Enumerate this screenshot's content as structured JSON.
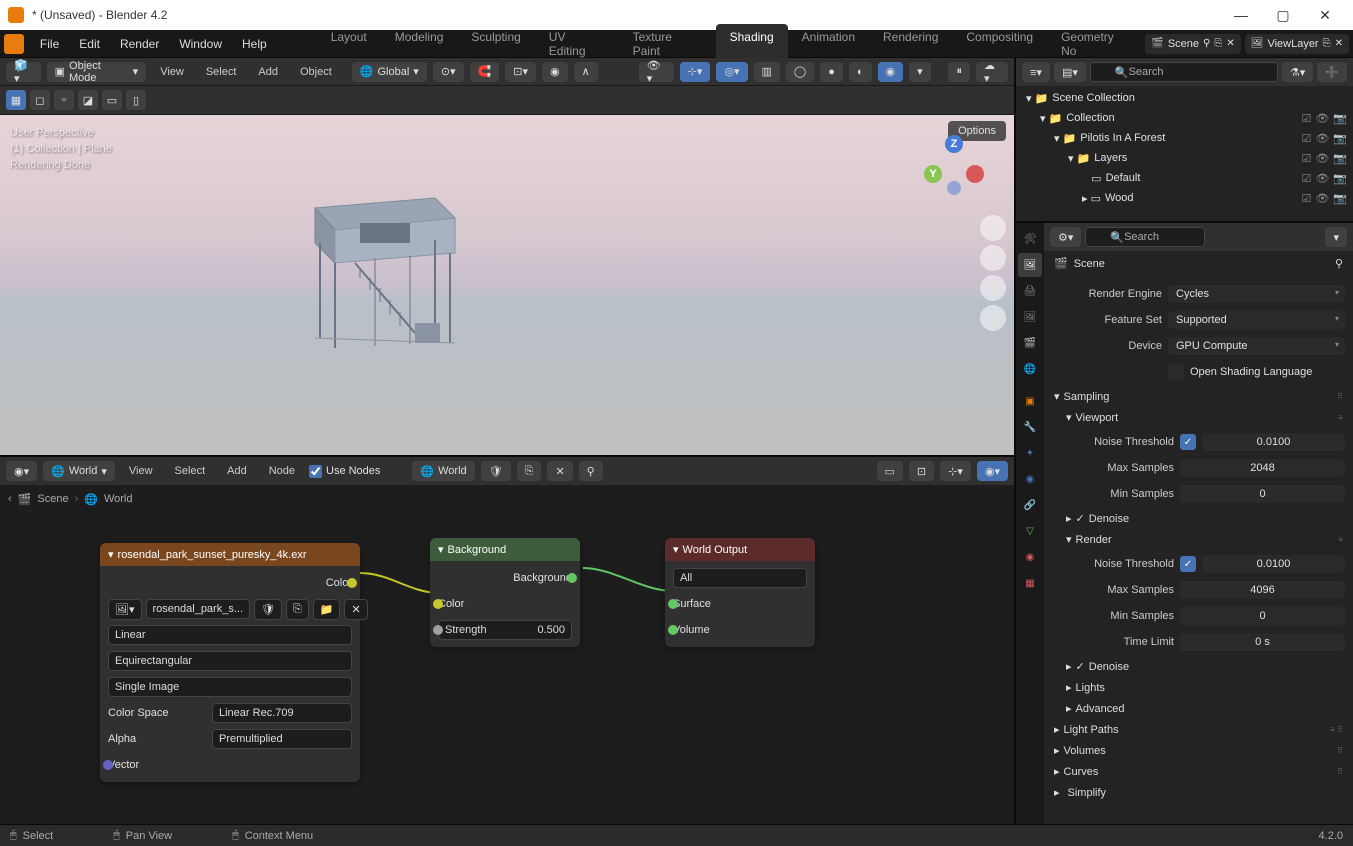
{
  "title": "* (Unsaved) - Blender 4.2",
  "menu": {
    "file": "File",
    "edit": "Edit",
    "render": "Render",
    "window": "Window",
    "help": "Help"
  },
  "tabs": [
    "Layout",
    "Modeling",
    "Sculpting",
    "UV Editing",
    "Texture Paint",
    "Shading",
    "Animation",
    "Rendering",
    "Compositing",
    "Geometry No"
  ],
  "active_tab": "Shading",
  "scene_name": "Scene",
  "layer_name": "ViewLayer",
  "vp_header": {
    "mode": "Object Mode",
    "view": "View",
    "select": "Select",
    "add": "Add",
    "object": "Object",
    "orient": "Global",
    "options": "Options"
  },
  "vp_overlay": {
    "l1": "User Perspective",
    "l2": "(1) Collection | Plane",
    "l3": "Rendering Done"
  },
  "ne_header": {
    "world": "World",
    "view": "View",
    "select": "Select",
    "add": "Add",
    "node": "Node",
    "use_nodes": "Use Nodes"
  },
  "breadcrumb": {
    "scene": "Scene",
    "world": "World"
  },
  "nodes": {
    "env": {
      "title": "rosendal_park_sunset_puresky_4k.exr",
      "color_out": "Color",
      "img": "rosendal_park_s...",
      "interp": "Linear",
      "proj": "Equirectangular",
      "single": "Single Image",
      "cs_label": "Color Space",
      "cs_val": "Linear Rec.709",
      "alpha_label": "Alpha",
      "alpha_val": "Premultiplied",
      "vector": "Vector"
    },
    "bg": {
      "title": "Background",
      "out": "Background",
      "color": "Color",
      "strength": "Strength",
      "strength_val": "0.500"
    },
    "wo": {
      "title": "World Output",
      "all": "All",
      "surface": "Surface",
      "volume": "Volume"
    }
  },
  "outliner": {
    "search": "Search",
    "items": [
      {
        "name": "Scene Collection",
        "indent": 0,
        "icon": "📁"
      },
      {
        "name": "Collection",
        "indent": 1,
        "icon": "📁"
      },
      {
        "name": "Pilotis In A Forest",
        "indent": 2,
        "icon": "📁"
      },
      {
        "name": "Layers",
        "indent": 3,
        "icon": "📁"
      },
      {
        "name": "Default",
        "indent": 4,
        "icon": "▭"
      },
      {
        "name": "Wood",
        "indent": 4,
        "icon": "▭"
      }
    ]
  },
  "props": {
    "search": "Search",
    "scene": "Scene",
    "engine_label": "Render Engine",
    "engine_val": "Cycles",
    "feature_label": "Feature Set",
    "feature_val": "Supported",
    "device_label": "Device",
    "device_val": "GPU Compute",
    "osl": "Open Shading Language",
    "sampling": "Sampling",
    "viewport": "Viewport",
    "noise_label": "Noise Threshold",
    "vp_noise": "0.0100",
    "maxs_label": "Max Samples",
    "vp_maxs": "2048",
    "mins_label": "Min Samples",
    "vp_mins": "0",
    "denoise": "Denoise",
    "render": "Render",
    "r_noise": "0.0100",
    "r_maxs": "4096",
    "r_mins": "0",
    "time_label": "Time Limit",
    "time_val": "0 s",
    "lights": "Lights",
    "advanced": "Advanced",
    "light_paths": "Light Paths",
    "volumes": "Volumes",
    "curves": "Curves",
    "simplify": "Simplify"
  },
  "status": {
    "select": "Select",
    "pan": "Pan View",
    "ctx": "Context Menu",
    "version": "4.2.0"
  }
}
